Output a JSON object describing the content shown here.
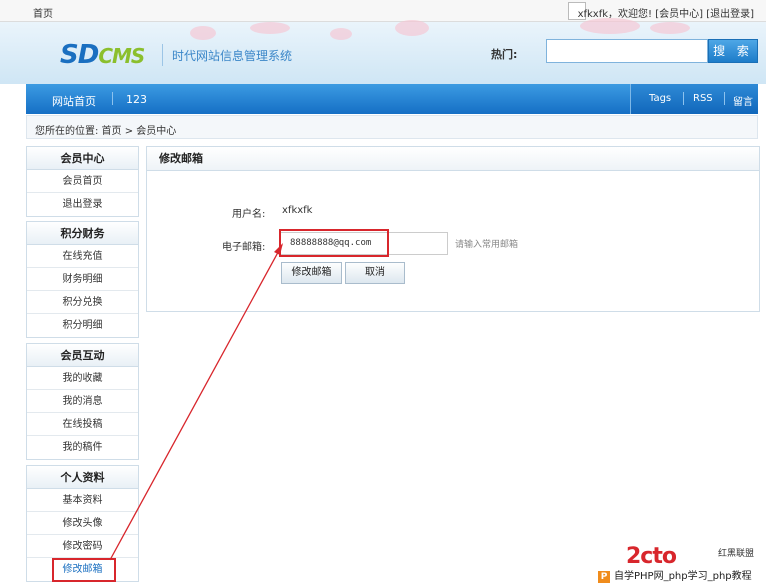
{
  "topbar": {
    "home": "首页",
    "user_text": "xfkxfk，欢迎您! [会员中心] [退出登录]"
  },
  "header": {
    "logo_sd": "SD",
    "logo_cms": "CMS",
    "slogan": "时代网站信息管理系统",
    "hot_label": "热门:",
    "search_value": "",
    "search_button": "搜 索"
  },
  "nav": {
    "items": [
      "网站首页",
      "123"
    ],
    "right_items": [
      "Tags",
      "RSS",
      "留言"
    ]
  },
  "breadcrumb": "您所在的位置: 首页 > 会员中心",
  "sidebar": [
    {
      "title": "会员中心",
      "items": [
        "会员首页",
        "退出登录"
      ]
    },
    {
      "title": "积分财务",
      "items": [
        "在线充值",
        "财务明细",
        "积分兑换",
        "积分明细"
      ]
    },
    {
      "title": "会员互动",
      "items": [
        "我的收藏",
        "我的消息",
        "在线投稿",
        "我的稿件"
      ]
    },
    {
      "title": "个人资料",
      "items": [
        "基本资料",
        "修改头像",
        "修改密码",
        "修改邮箱"
      ]
    }
  ],
  "panel": {
    "title": "修改邮箱",
    "username_label": "用户名:",
    "username_value": "xfkxfk",
    "email_label": "电子邮箱:",
    "email_value": "88888888@qq.com",
    "email_hint": "请输入常用邮箱",
    "submit_button": "修改邮箱",
    "cancel_button": "取消"
  },
  "watermark": {
    "logo": "2cto",
    "tag": "红黑联盟",
    "text": "自学PHP网_php学习_php教程"
  },
  "colors": {
    "accent": "#1d7cc9",
    "annotation": "#d8262c"
  }
}
